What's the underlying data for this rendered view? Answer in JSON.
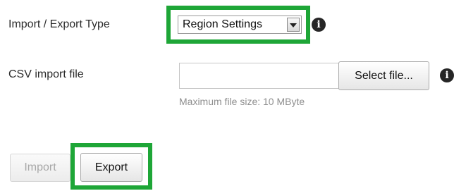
{
  "import_export_type": {
    "label": "Import / Export Type",
    "selected": "Region Settings",
    "info_glyph": "i"
  },
  "csv_import": {
    "label": "CSV import file",
    "file_value": "",
    "select_button": "Select file...",
    "hint": "Maximum file size: 10 MByte",
    "info_glyph": "i"
  },
  "actions": {
    "import_label": "Import",
    "export_label": "Export"
  },
  "colors": {
    "highlight": "#1ea637"
  },
  "icons": [
    "info-icon",
    "dropdown-arrow-icon"
  ]
}
